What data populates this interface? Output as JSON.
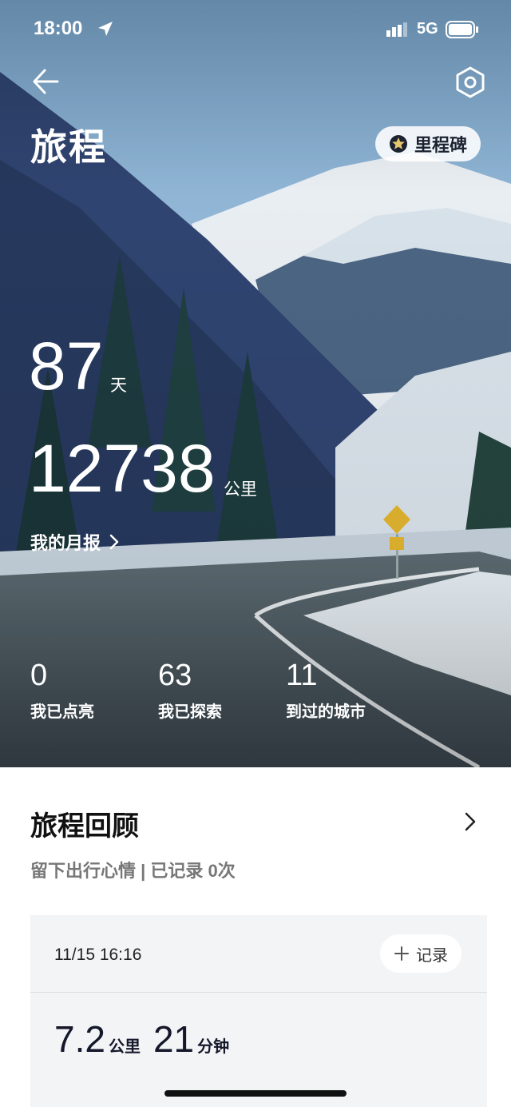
{
  "status_bar": {
    "time": "18:00",
    "network": "5G"
  },
  "header": {
    "title": "旅程",
    "milestone_label": "里程碑"
  },
  "stats": {
    "days": "87",
    "days_unit": "天",
    "distance": "12738",
    "distance_unit": "公里",
    "monthly_report_label": "我的月报",
    "lit": {
      "value": "0",
      "label": "我已点亮"
    },
    "explored": {
      "value": "63",
      "label": "我已探索"
    },
    "cities": {
      "value": "11",
      "label": "到过的城市"
    }
  },
  "review": {
    "title": "旅程回顾",
    "subtitle": "留下出行心情 | 已记录 0次",
    "card": {
      "datetime": "11/15 16:16",
      "record_label": "记录",
      "distance": "7.2",
      "distance_unit": "公里",
      "duration": "21",
      "duration_unit": "分钟"
    }
  },
  "icons": [
    "location-arrow-icon",
    "signal-icon",
    "battery-icon",
    "back-arrow-icon",
    "settings-hexagon-icon",
    "star-badge-icon",
    "chevron-right-icon",
    "plus-icon"
  ]
}
